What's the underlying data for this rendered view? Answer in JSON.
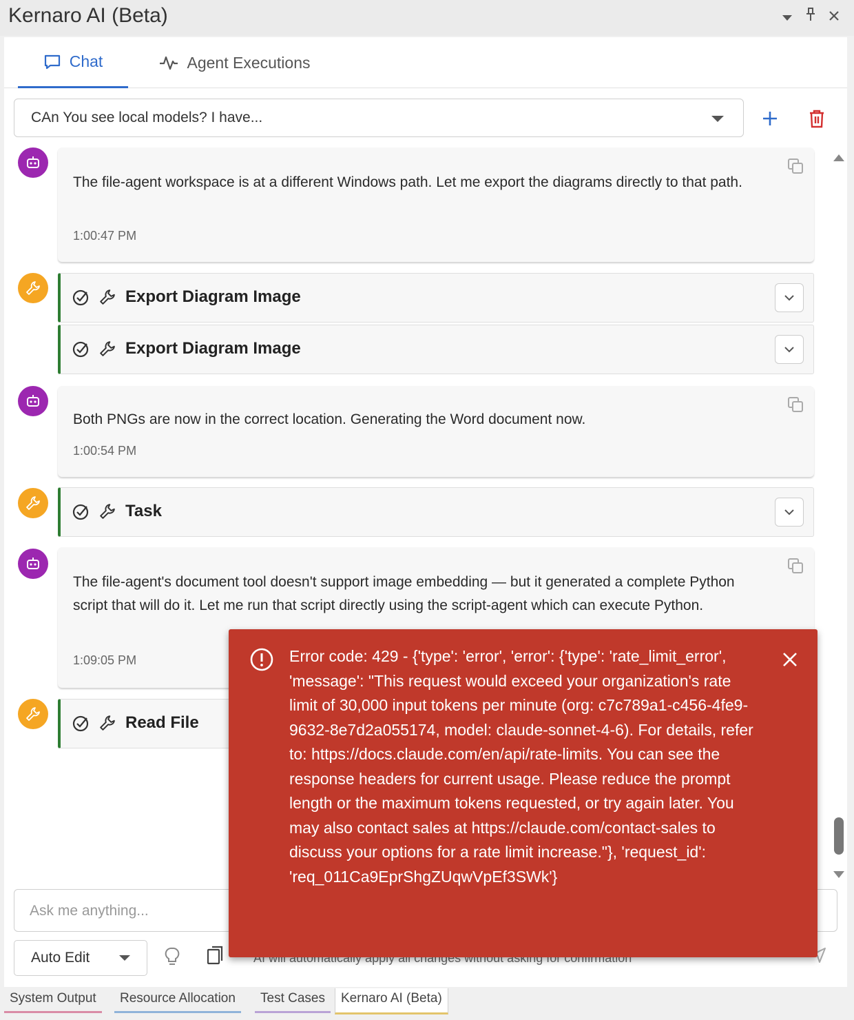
{
  "window": {
    "title": "Kernaro AI (Beta)",
    "controls": [
      "dropdown-icon",
      "pin-icon",
      "close-icon"
    ]
  },
  "tabs": [
    {
      "label": "Chat",
      "icon": "chat-bubble-icon",
      "active": true
    },
    {
      "label": "Agent Executions",
      "icon": "activity-icon",
      "active": false
    }
  ],
  "conversation": {
    "selected": "CAn You see local models? I have..."
  },
  "messages": [
    {
      "type": "bot",
      "text": "The file-agent workspace is at a different Windows path. Let me export the diagrams directly to that path.",
      "time": "1:00:47 PM"
    },
    {
      "type": "tool",
      "name": "Export Diagram Image"
    },
    {
      "type": "tool",
      "name": "Export Diagram Image"
    },
    {
      "type": "bot",
      "text": "Both PNGs are now in the correct location. Generating the Word document now.",
      "time": "1:00:54 PM"
    },
    {
      "type": "tool",
      "name": "Task"
    },
    {
      "type": "bot",
      "text": "The file-agent's document tool doesn't support image embedding — but it generated a complete Python script that will do it. Let me run that script directly using the script-agent which can execute Python.",
      "time": "1:09:05 PM"
    },
    {
      "type": "tool",
      "name": "Read File"
    }
  ],
  "input": {
    "placeholder": "Ask me anything..."
  },
  "footer": {
    "mode": "Auto Edit",
    "mode_hint": "AI will automatically apply all changes without asking for confirmation"
  },
  "bottom_tabs": [
    {
      "label": "System Output",
      "accent": "#d98ca6"
    },
    {
      "label": "Resource Allocation",
      "accent": "#8fb3d9"
    },
    {
      "label": "Test Cases",
      "accent": "#b9a3d6"
    },
    {
      "label": "Kernaro AI (Beta)",
      "accent": "#e3c46b",
      "active": true
    }
  ],
  "error_toast": {
    "message": "Error code: 429 - {'type': 'error', 'error': {'type': 'rate_limit_error', 'message': \"This request would exceed your organization's rate limit of 30,000 input tokens per minute (org: c7c789a1-c456-4fe9-9632-8e7d2a055174, model: claude-sonnet-4-6). For details, refer to: https://docs.claude.com/en/api/rate-limits. You can see the response headers for current usage. Please reduce the prompt length or the maximum tokens requested, or try again later. You may also contact sales at https://claude.com/contact-sales to discuss your options for a rate limit increase.\"}, 'request_id': 'req_011Ca9EprShgZUqwVpEf3SWk'}",
    "color": "#c0392b"
  },
  "colors": {
    "accent": "#2f6bcb",
    "bot_avatar": "#9c27b0",
    "tool_avatar": "#f5a623",
    "tool_success": "#2e7d32",
    "delete": "#d32f2f"
  }
}
